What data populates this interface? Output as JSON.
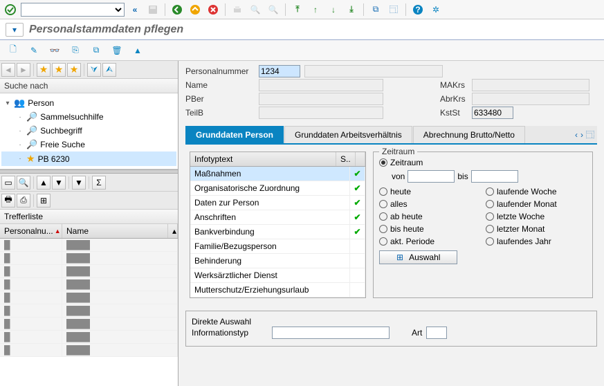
{
  "app": {
    "title": "Personalstammdaten pflegen"
  },
  "header": {
    "fields": {
      "persnr_label": "Personalnummer",
      "persnr": "1234",
      "name_label": "Name",
      "name": "",
      "makrs_label": "MAKrs",
      "makrs": "",
      "pber_label": "PBer",
      "pber": "",
      "abrkrs_label": "AbrKrs",
      "abrkrs": "",
      "teilb_label": "TeilB",
      "teilb": "",
      "kstst_label": "KstSt",
      "kstst": "633480"
    }
  },
  "search": {
    "title": "Suche nach",
    "tree": [
      {
        "label": "Person",
        "icon": "person",
        "expanded": true
      },
      {
        "label": "Sammelsuchhilfe",
        "icon": "binoc"
      },
      {
        "label": "Suchbegriff",
        "icon": "binoc"
      },
      {
        "label": "Freie Suche",
        "icon": "binoc"
      },
      {
        "label": "PB 6230",
        "icon": "star",
        "selected": true
      }
    ]
  },
  "hitlist": {
    "title": "Trefferliste",
    "cols": {
      "c1": "Personalnu...",
      "c2": "Name"
    },
    "rows_count": 9
  },
  "tabs": {
    "items": [
      "Grunddaten Person",
      "Grunddaten Arbeitsverhältnis",
      "Abrechnung Brutto/Netto"
    ],
    "active": 0
  },
  "infotypes": {
    "header": {
      "text": "Infotyptext",
      "status": "S.."
    },
    "rows": [
      {
        "text": "Maßnahmen",
        "check": true,
        "sel": true
      },
      {
        "text": "Organisatorische Zuordnung",
        "check": true
      },
      {
        "text": "Daten zur Person",
        "check": true
      },
      {
        "text": "Anschriften",
        "check": true
      },
      {
        "text": "Bankverbindung",
        "check": true
      },
      {
        "text": "Familie/Bezugsperson",
        "check": false
      },
      {
        "text": "Behinderung",
        "check": false
      },
      {
        "text": "Werksärztlicher Dienst",
        "check": false
      },
      {
        "text": "Mutterschutz/Erziehungsurlaub",
        "check": false
      }
    ]
  },
  "period": {
    "legend": "Zeitraum",
    "zeitraum": "Zeitraum",
    "von": "von",
    "bis": "bis",
    "opts": [
      "heute",
      "laufende Woche",
      "alles",
      "laufender Monat",
      "ab heute",
      "letzte Woche",
      "bis heute",
      "letzter Monat",
      "akt. Periode",
      "laufendes Jahr"
    ],
    "auswahl": "Auswahl"
  },
  "direct": {
    "legend": "Direkte Auswahl",
    "infotype": "Informationstyp",
    "art": "Art"
  }
}
